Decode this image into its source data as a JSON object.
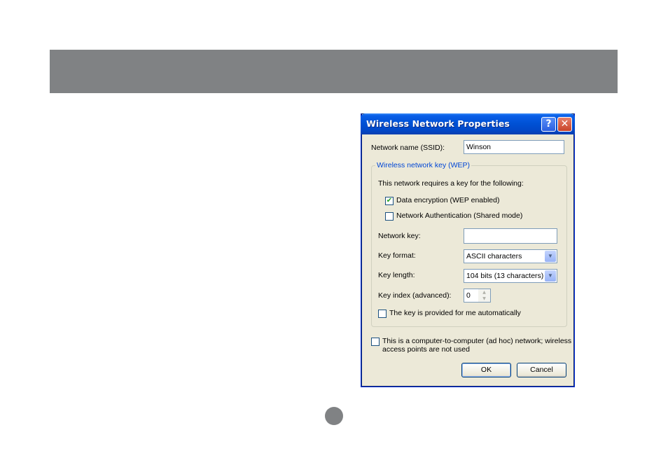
{
  "dialog": {
    "title": "Wireless Network Properties",
    "help_glyph": "?",
    "close_glyph": "✕",
    "ssid_label": "Network name (SSID):",
    "ssid_value": "Winson",
    "group_title": "Wireless network key (WEP)",
    "requires_text": "This network requires a key for the following:",
    "data_encryption": {
      "label": "Data encryption (WEP enabled)",
      "checked": true
    },
    "network_auth": {
      "label": "Network Authentication (Shared mode)",
      "checked": false
    },
    "network_key_label": "Network key:",
    "network_key_value": "",
    "key_format_label": "Key format:",
    "key_format_value": "ASCII characters",
    "key_length_label": "Key length:",
    "key_length_value": "104 bits (13 characters)",
    "key_index_label": "Key index (advanced):",
    "key_index_value": "0",
    "auto_key": {
      "label": "The key is provided for me automatically",
      "checked": false
    },
    "adhoc": {
      "label_line1": "This is a computer-to-computer (ad hoc) network; wireless",
      "label_line2": "access points are not used",
      "checked": false
    },
    "ok_label": "OK",
    "cancel_label": "Cancel"
  },
  "icons": {
    "check_glyph": "✔",
    "dropdown_glyph": "▼",
    "spin_up": "▲",
    "spin_down": "▼"
  },
  "colors": {
    "band": "#808284",
    "titlebar": "#0052d6",
    "dialog_bg": "#ece9d8",
    "group_title": "#0046d5"
  }
}
